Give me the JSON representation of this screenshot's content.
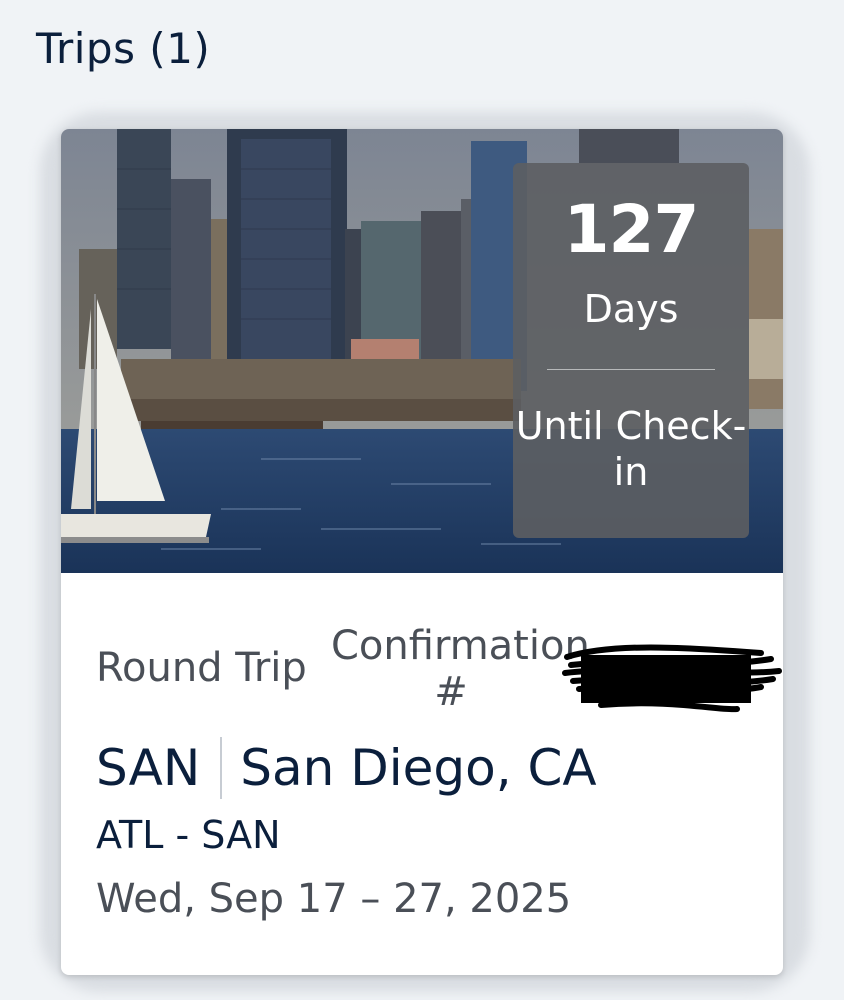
{
  "header": {
    "title": "Trips (1)"
  },
  "trip": {
    "countdown": {
      "number": "127",
      "unit": "Days",
      "label": "Until Check-in"
    },
    "trip_type": "Round Trip",
    "confirmation_label": "Confirmation #",
    "destination_code": "SAN",
    "destination_city": "San Diego, CA",
    "route": "ATL - SAN",
    "dates": "Wed, Sep 17 – 27, 2025"
  },
  "colors": {
    "navy": "#0b1f3c",
    "gray_text": "#4a4f57",
    "badge_bg": "#5c5e62",
    "page_bg": "#f0f3f6"
  }
}
